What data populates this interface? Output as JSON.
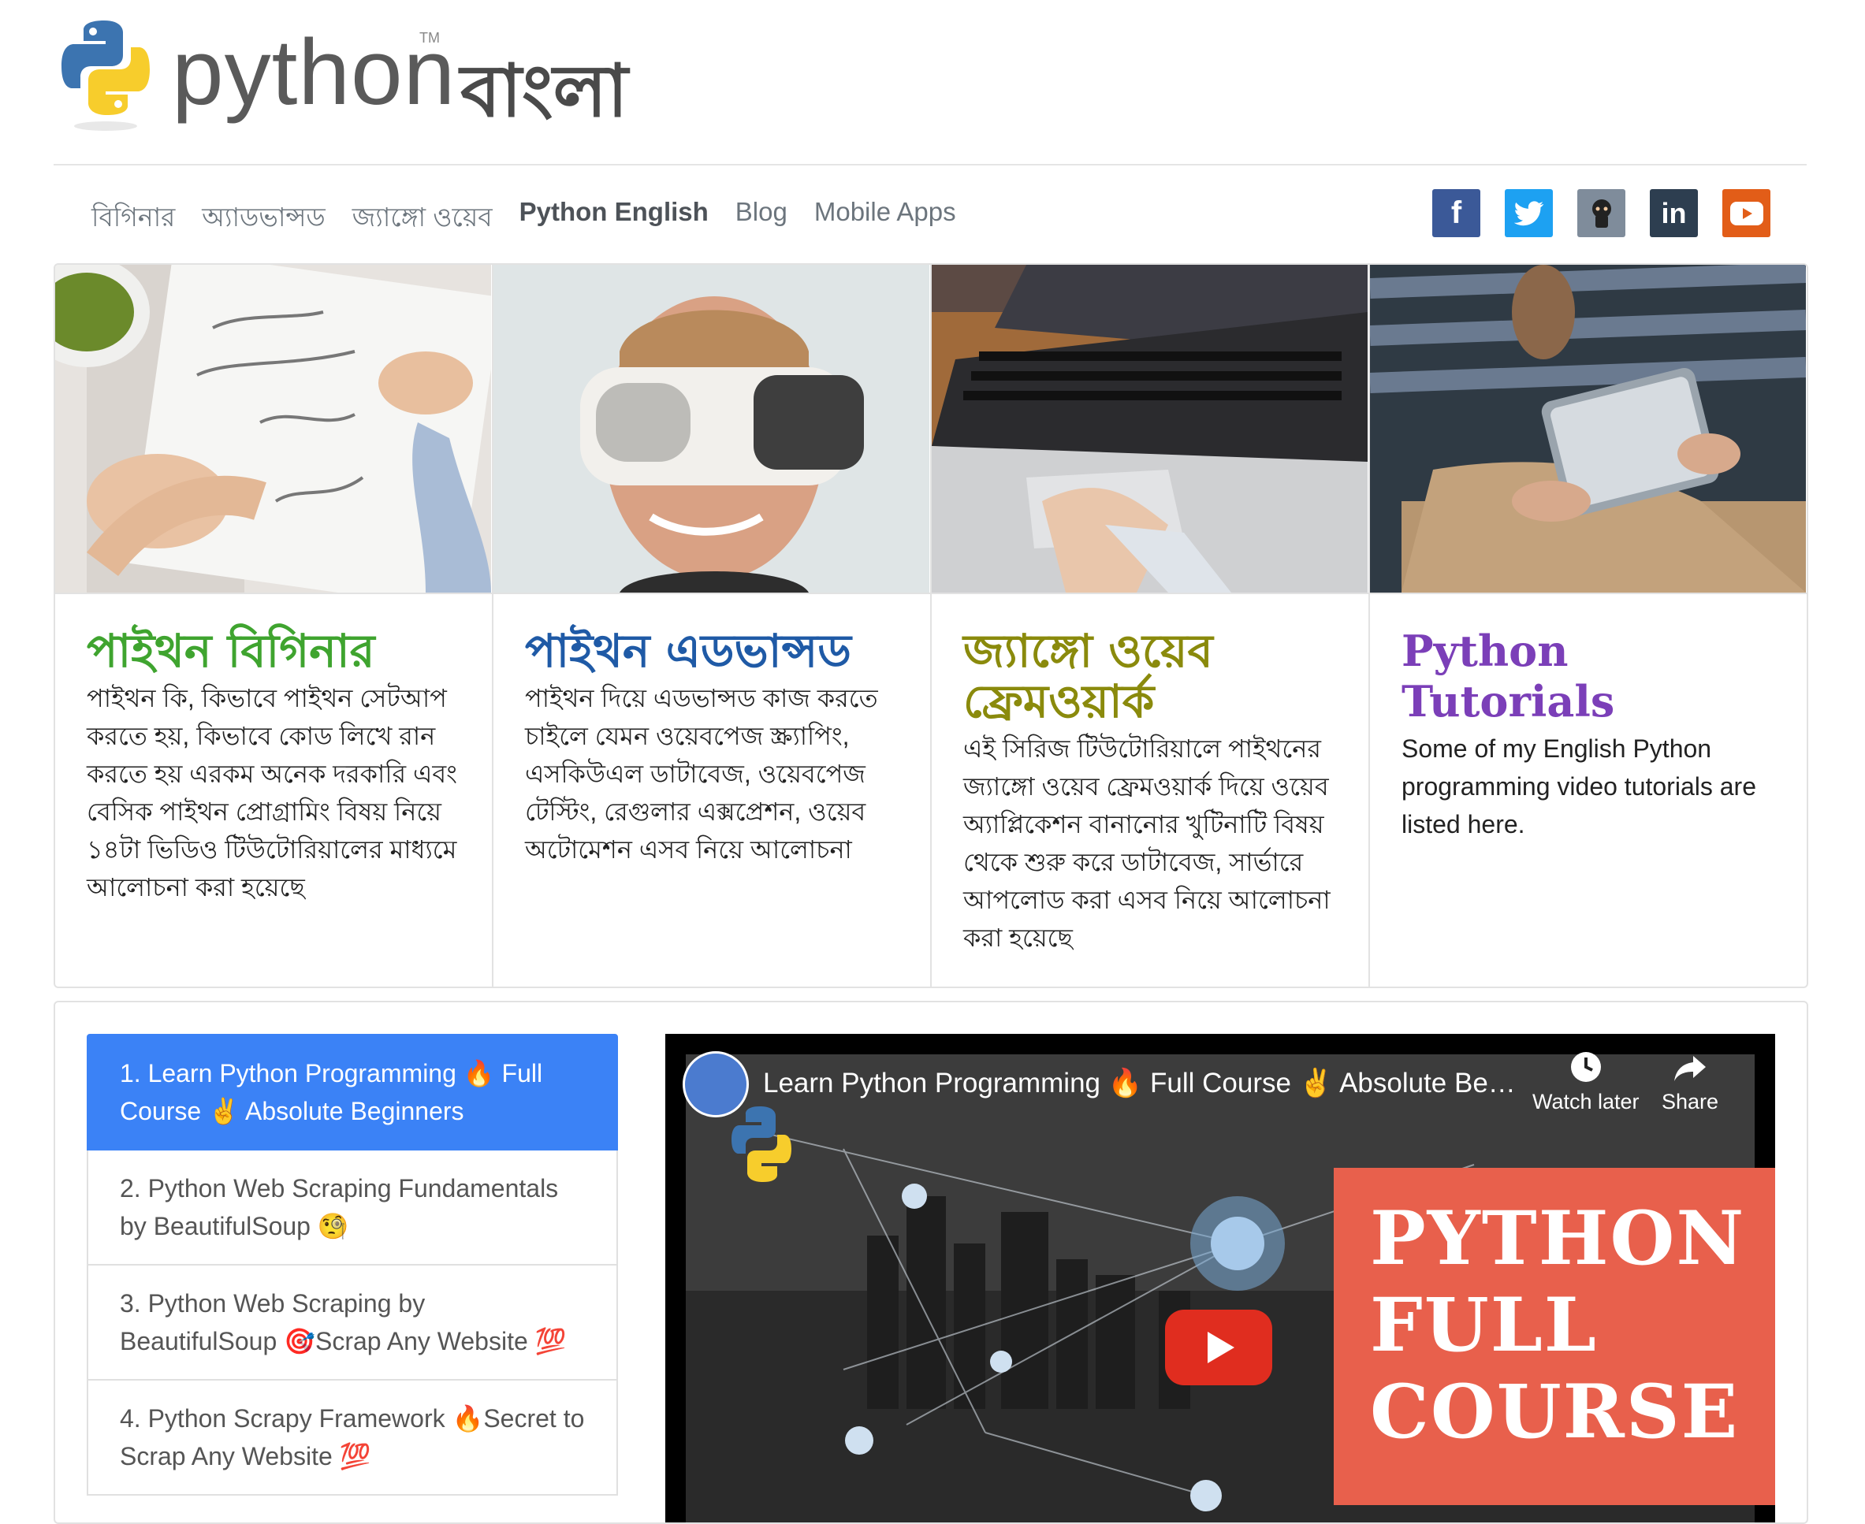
{
  "header": {
    "logo_word": "python",
    "logo_tm": "TM",
    "logo_bangla": "বাংলা"
  },
  "nav": {
    "items": [
      {
        "label": "বিগিনার"
      },
      {
        "label": "অ্যাডভান্সড"
      },
      {
        "label": "জ্যাঙ্গো ওয়েব"
      },
      {
        "label": "Python English"
      },
      {
        "label": "Blog"
      },
      {
        "label": "Mobile Apps"
      }
    ]
  },
  "social": [
    {
      "icon": "facebook-icon",
      "glyph": "f",
      "color": "#3b5998"
    },
    {
      "icon": "twitter-icon",
      "glyph": "t",
      "color": "#1da1f2"
    },
    {
      "icon": "github-icon",
      "glyph": "◉",
      "color": "#7f8c9b"
    },
    {
      "icon": "linkedin-icon",
      "glyph": "in",
      "color": "#2d3e50"
    },
    {
      "icon": "youtube-icon",
      "glyph": "▶",
      "color": "#e25d18"
    }
  ],
  "cards": [
    {
      "title": "পাইথন বিগিনার",
      "title_color": "#3fa42f",
      "text": "পাইথন কি, কিভাবে পাইথন সেটআপ করতে হয়, কিভাবে কোড লিখে রান করতে হয় এরকম অনেক দরকারি এবং বেসিক পাইথন প্রোগ্রামিং বিষয় নিয়ে ১৪টা ভিডিও টিউটোরিয়ালের মাধ্যমে আলোচনা করা হয়েছে"
    },
    {
      "title": "পাইথন এডভান্সড",
      "title_color": "#1f5aa6",
      "text": "পাইথন দিয়ে এডভান্সড কাজ করতে চাইলে যেমন ওয়েবপেজ স্ক্র্যাপিং, এসকিউএল ডাটাবেজ, ওয়েবপেজ টেস্টিং, রেগুলার এক্সপ্রেশন, ওয়েব অটোমেশন এসব নিয়ে আলোচনা"
    },
    {
      "title": "জ্যাঙ্গো ওয়েব ফ্রেমওয়ার্ক",
      "title_color": "#8a8a0c",
      "text": "এই সিরিজ টিউটোরিয়ালে পাইথনের জ্যাঙ্গো ওয়েব ফ্রেমওয়ার্ক দিয়ে ওয়েব অ্যাপ্লিকেশন বানানোর খুটিনাটি বিষয় থেকে শুরু করে ডাটাবেজ, সার্ভারে আপলোড করা এসব নিয়ে আলোচনা করা হয়েছে"
    },
    {
      "title": "Python Tutorials",
      "title_color": "#7b3fb8",
      "text": "Some of my English Python programming video tutorials are listed here."
    }
  ],
  "playlist": [
    {
      "label": "1. Learn Python Programming 🔥 Full Course ✌️ Absolute Beginners"
    },
    {
      "label": "2. Python Web Scraping Fundamentals by BeautifulSoup 🧐"
    },
    {
      "label": "3. Python Web Scraping by BeautifulSoup 🎯Scrap Any Website 💯"
    },
    {
      "label": "4. Python Scrapy Framework 🔥Secret to Scrap Any Website 💯"
    }
  ],
  "video": {
    "title": "Learn Python Programming 🔥 Full Course ✌️ Absolute Be…",
    "watch_later": "Watch later",
    "share": "Share",
    "promo_line1": "PYTHON",
    "promo_line2": "FULL",
    "promo_line3": "COURSE"
  }
}
